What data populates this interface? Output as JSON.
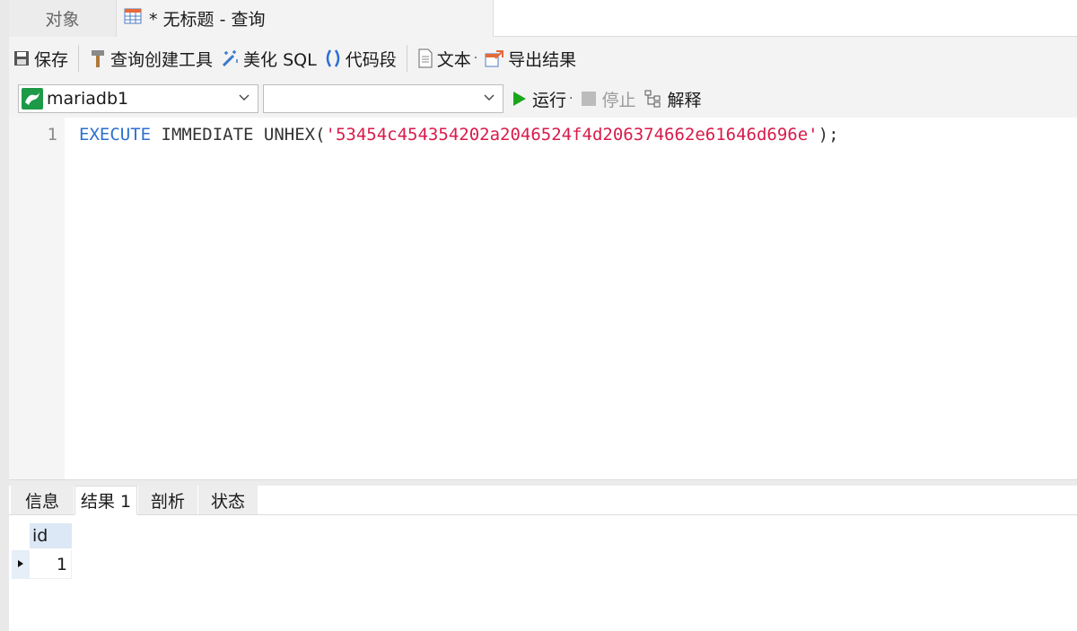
{
  "tabs": {
    "objects_label": "对象",
    "query_label": "* 无标题 - 查询"
  },
  "toolbar": {
    "save_label": "保存",
    "query_builder_label": "查询创建工具",
    "beautify_label": "美化 SQL",
    "snippet_label": "代码段",
    "text_label": "文本",
    "export_label": "导出结果"
  },
  "connection_bar": {
    "connection_value": "mariadb1",
    "database_value": "",
    "run_label": "运行",
    "stop_label": "停止",
    "explain_label": "解释"
  },
  "editor": {
    "line_number": "1",
    "kw_execute": "EXECUTE",
    "kw_rest": " IMMEDIATE UNHEX(",
    "string_literal": "'53454c454354202a2046524f4d206374662e61646d696e'",
    "tail": ");"
  },
  "result_tabs": [
    "信息",
    "结果 1",
    "剖析",
    "状态"
  ],
  "result_grid": {
    "columns": [
      "id"
    ],
    "rows": [
      [
        "1"
      ]
    ]
  },
  "colors": {
    "keyword": "#2c6fd1",
    "string": "#d81b4a",
    "run_green": "#1aa61a"
  }
}
